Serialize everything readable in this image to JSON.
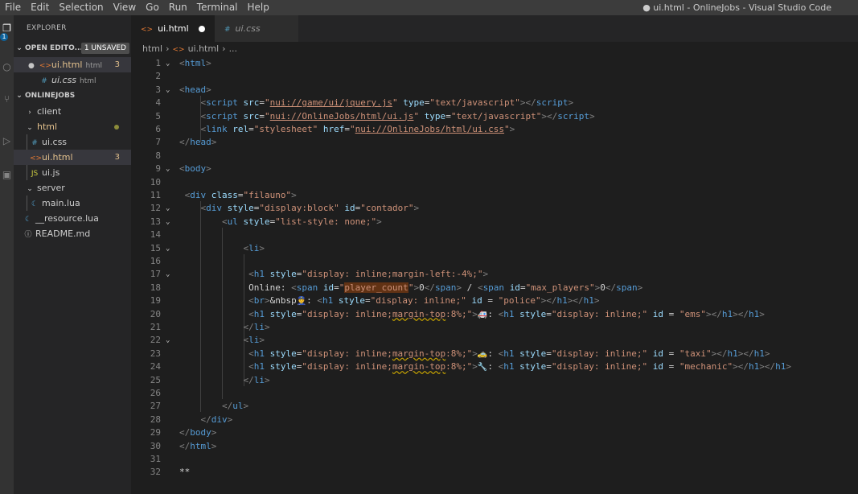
{
  "menu": [
    "File",
    "Edit",
    "Selection",
    "View",
    "Go",
    "Run",
    "Terminal",
    "Help"
  ],
  "window_title": "● ui.html - OnlineJobs - Visual Studio Code",
  "activity_badge": "1",
  "sidebar": {
    "title": "EXPLORER",
    "open_editors": {
      "label": "OPEN EDITO...",
      "badge": "1 UNSAVED"
    },
    "open_files": [
      {
        "name": "ui.html",
        "sub": "html",
        "count": "3"
      },
      {
        "name": "ui.css",
        "sub": "html"
      }
    ],
    "project": "ONLINEJOBS",
    "tree": [
      {
        "name": "client"
      },
      {
        "name": "html"
      },
      {
        "name": "ui.css"
      },
      {
        "name": "ui.html",
        "count": "3"
      },
      {
        "name": "ui.js"
      },
      {
        "name": "server"
      },
      {
        "name": "main.lua"
      },
      {
        "name": "__resource.lua"
      },
      {
        "name": "README.md"
      }
    ]
  },
  "tabs": [
    {
      "label": "ui.html"
    },
    {
      "label": "ui.css"
    }
  ],
  "breadcrumb": {
    "folder": "html",
    "file": "ui.html",
    "rest": "..."
  },
  "editor": {
    "line_numbers": [
      "1",
      "2",
      "3",
      "4",
      "5",
      "6",
      "7",
      "8",
      "9",
      "10",
      "11",
      "12",
      "13",
      "14",
      "15",
      "16",
      "17",
      "18",
      "19",
      "20",
      "21",
      "22",
      "23",
      "24",
      "25",
      "26",
      "27",
      "28",
      "29",
      "30",
      "31",
      "32"
    ],
    "emoji": {
      "police": "👮",
      "ems": "🚑",
      "taxi": "🚕",
      "mechanic": "🔧"
    },
    "text_online": "Online: ",
    "text_br_nbsp": "&nbsp",
    "text_zero": "0",
    "text_slash": " / ",
    "last_line": "**"
  }
}
